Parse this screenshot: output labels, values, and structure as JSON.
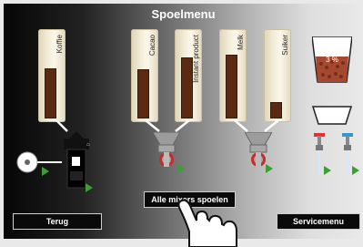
{
  "title": "Spoelmenu",
  "canisters": [
    {
      "name": "koffie-canister",
      "label": "Koffie",
      "level": 0.72
    },
    {
      "name": "cacao-canister",
      "label": "Cacao",
      "level": 0.7
    },
    {
      "name": "instant-product-canister",
      "label": "Instant product",
      "level": 0.88
    },
    {
      "name": "melk-canister",
      "label": "Melk",
      "level": 0.92
    },
    {
      "name": "suiker-canister",
      "label": "Suiker",
      "level": 0.22
    }
  ],
  "bean_container": {
    "percentage": "3 %"
  },
  "buttons": {
    "rinse_all": "Alle mixers spoelen",
    "back": "Terug",
    "service": "Servicemenu"
  },
  "colors": {
    "run_arrow": "#3aa033",
    "product_brown": "#5a2a12"
  }
}
